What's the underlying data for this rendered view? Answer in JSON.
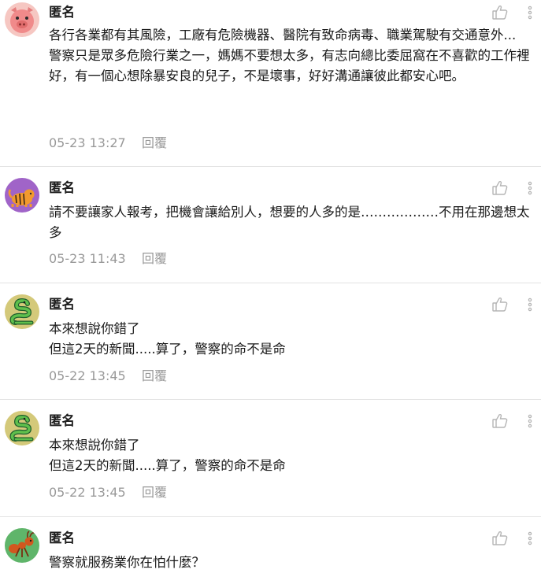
{
  "comments": [
    {
      "author": "匿名",
      "avatar": "pig-avatar",
      "text": "各行各業都有其風險，工廠有危險機器、醫院有致命病毒、職業駕駛有交通意外...\n警察只是眾多危險行業之一，媽媽不要想太多，有志向總比委屈窩在不喜歡的工作裡好，有一個心想除暴安良的兒子，不是壞事，好好溝通讓彼此都安心吧。",
      "time": "05-23 13:27",
      "reply": "回覆"
    },
    {
      "author": "匿名",
      "avatar": "tiger-avatar",
      "text": "請不要讓家人報考，把機會讓給別人，想要的人多的是………………不用在那邊想太多",
      "time": "05-23 11:43",
      "reply": "回覆"
    },
    {
      "author": "匿名",
      "avatar": "snake-avatar",
      "text": "本來想說你錯了\n但這2天的新聞.....算了，警察的命不是命",
      "time": "05-22 13:45",
      "reply": "回覆"
    },
    {
      "author": "匿名",
      "avatar": "snake-avatar",
      "text": "本來想說你錯了\n但這2天的新聞.....算了，警察的命不是命",
      "time": "05-22 13:45",
      "reply": "回覆"
    },
    {
      "author": "匿名",
      "avatar": "ant-avatar",
      "text": "警察就服務業你在怕什麼？",
      "time": "",
      "reply": ""
    }
  ],
  "colors": {
    "pig": "#f08a8a",
    "tiger_bg": "#a064c8",
    "snake_bg": "#d4c97a",
    "ant_bg": "#5fb56a",
    "divider": "#e3e3e3",
    "meta": "#999999"
  },
  "icons": {
    "like": "thumbs-up-icon",
    "more": "more-vertical-icon"
  }
}
